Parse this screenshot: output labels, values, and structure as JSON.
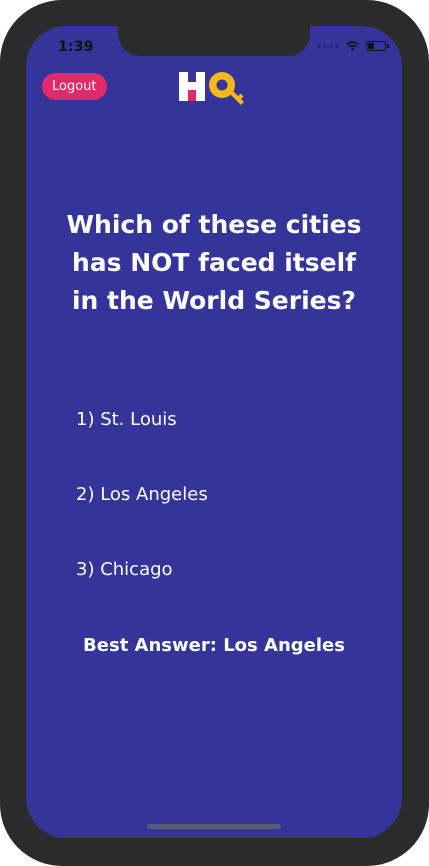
{
  "status_bar": {
    "time": "1:39"
  },
  "header": {
    "logout_label": "Logout",
    "logo_icon": "hq-key-logo"
  },
  "question": {
    "text": "Which of these cities has NOT faced itself in the World Series?"
  },
  "answers": [
    {
      "label": "1) St. Louis"
    },
    {
      "label": "2) Los Angeles"
    },
    {
      "label": "3) Chicago"
    }
  ],
  "best_answer": {
    "text": "Best Answer: Los Angeles"
  },
  "colors": {
    "background": "#35349a",
    "accent": "#e2296a",
    "logo_yellow": "#f5b81c",
    "logo_pink": "#e2296a"
  }
}
